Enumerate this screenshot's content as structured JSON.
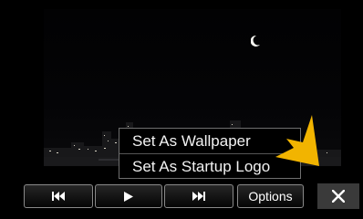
{
  "menu": {
    "items": [
      {
        "label": "Set As Wallpaper"
      },
      {
        "label": "Set As Startup Logo"
      }
    ]
  },
  "controls": {
    "prev_icon": "skip-previous-icon",
    "play_icon": "play-icon",
    "next_icon": "skip-next-icon",
    "options_label": "Options",
    "close_icon": "close-icon"
  },
  "colors": {
    "arrow": "#f2b400",
    "close_bg": "#3a3a3a"
  }
}
